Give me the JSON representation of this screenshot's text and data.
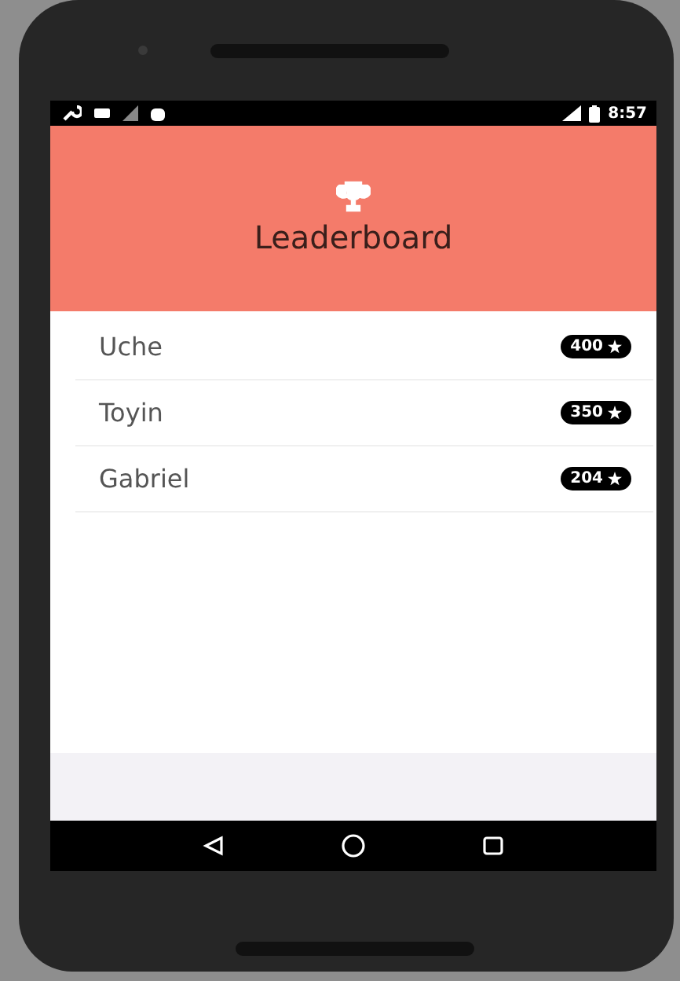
{
  "status_bar": {
    "time": "8:57"
  },
  "header": {
    "title": "Leaderboard"
  },
  "players": [
    {
      "name": "Uche",
      "score": "400"
    },
    {
      "name": "Toyin",
      "score": "350"
    },
    {
      "name": "Gabriel",
      "score": "204"
    }
  ]
}
